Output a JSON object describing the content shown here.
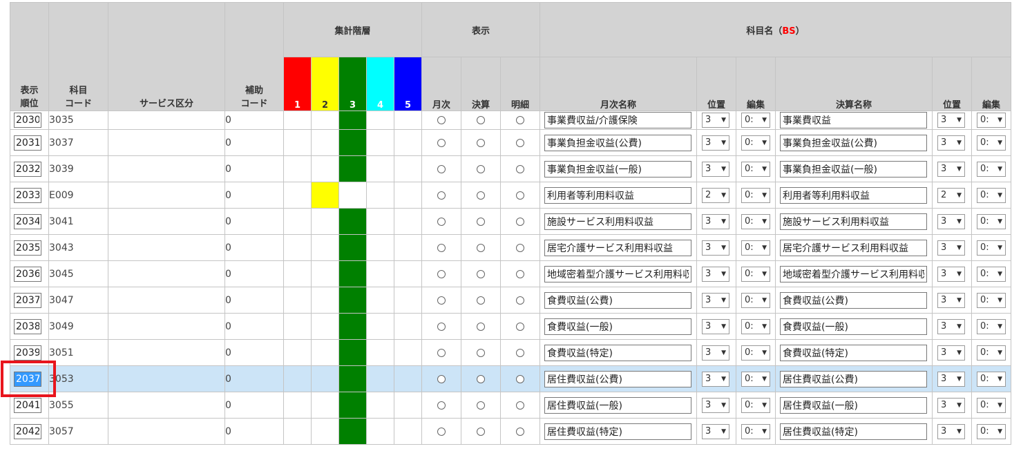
{
  "headers": {
    "order": "表示\n順位",
    "code": "科目\nコード",
    "service": "サービス区分",
    "hojo": "補助\nコード",
    "level_group": "集計階層",
    "levels": [
      "1",
      "2",
      "3",
      "4",
      "5"
    ],
    "display_group": "表示",
    "display": [
      "月次",
      "決算",
      "明細"
    ],
    "name_group_prefix": "科目名（",
    "name_group_tag": "BS",
    "name_group_suffix": "）",
    "monthly_name": "月次名称",
    "position": "位置",
    "edit": "編集",
    "closing_name": "決算名称",
    "position2": "位置",
    "edit2": "編集"
  },
  "colors": {
    "level1": "#ff0000",
    "level2": "#ffff00",
    "level3": "#008000",
    "level4": "#00ffff",
    "level5": "#0000ff",
    "selected_row": "#cce4f7",
    "highlight": "#e8151d"
  },
  "rows": [
    {
      "order": "2030",
      "code": "3035",
      "hojo": "0",
      "level": 3,
      "monthly": "事業費収益/介護保険",
      "pos": "3",
      "edit": "0:",
      "closing": "事業費収益",
      "pos2": "3",
      "edit2": "0:",
      "partial": true
    },
    {
      "order": "2031",
      "code": "3037",
      "hojo": "0",
      "level": 3,
      "monthly": "事業負担金収益(公費)",
      "pos": "3",
      "edit": "0:",
      "closing": "事業負担金収益(公費)",
      "pos2": "3",
      "edit2": "0:"
    },
    {
      "order": "2032",
      "code": "3039",
      "hojo": "0",
      "level": 3,
      "monthly": "事業負担金収益(一般)",
      "pos": "3",
      "edit": "0:",
      "closing": "事業負担金収益(一般)",
      "pos2": "3",
      "edit2": "0:"
    },
    {
      "order": "2033",
      "code": "E009",
      "hojo": "0",
      "level": 2,
      "monthly": "利用者等利用料収益",
      "pos": "2",
      "edit": "0:",
      "closing": "利用者等利用料収益",
      "pos2": "2",
      "edit2": "0:"
    },
    {
      "order": "2034",
      "code": "3041",
      "hojo": "0",
      "level": 3,
      "monthly": "施設サービス利用料収益",
      "pos": "3",
      "edit": "0:",
      "closing": "施設サービス利用料収益",
      "pos2": "3",
      "edit2": "0:"
    },
    {
      "order": "2035",
      "code": "3043",
      "hojo": "0",
      "level": 3,
      "monthly": "居宅介護サービス利用料収益",
      "pos": "3",
      "edit": "0:",
      "closing": "居宅介護サービス利用料収益",
      "pos2": "3",
      "edit2": "0:"
    },
    {
      "order": "2036",
      "code": "3045",
      "hojo": "0",
      "level": 3,
      "monthly": "地域密着型介護サービス利用料収益",
      "pos": "3",
      "edit": "0:",
      "closing": "地域密着型介護サービス利用料収益",
      "pos2": "3",
      "edit2": "0:"
    },
    {
      "order": "2037",
      "code": "3047",
      "hojo": "0",
      "level": 3,
      "monthly": "食費収益(公費)",
      "pos": "3",
      "edit": "0:",
      "closing": "食費収益(公費)",
      "pos2": "3",
      "edit2": "0:"
    },
    {
      "order": "2038",
      "code": "3049",
      "hojo": "0",
      "level": 3,
      "monthly": "食費収益(一般)",
      "pos": "3",
      "edit": "0:",
      "closing": "食費収益(一般)",
      "pos2": "3",
      "edit2": "0:"
    },
    {
      "order": "2039",
      "code": "3051",
      "hojo": "0",
      "level": 3,
      "monthly": "食費収益(特定)",
      "pos": "3",
      "edit": "0:",
      "closing": "食費収益(特定)",
      "pos2": "3",
      "edit2": "0:"
    },
    {
      "order": "2037",
      "code": "3053",
      "hojo": "0",
      "level": 3,
      "monthly": "居住費収益(公費)",
      "pos": "3",
      "edit": "0:",
      "closing": "居住費収益(公費)",
      "pos2": "3",
      "edit2": "0:",
      "selected": true
    },
    {
      "order": "2041",
      "code": "3055",
      "hojo": "0",
      "level": 3,
      "monthly": "居住費収益(一般)",
      "pos": "3",
      "edit": "0:",
      "closing": "居住費収益(一般)",
      "pos2": "3",
      "edit2": "0:"
    },
    {
      "order": "2042",
      "code": "3057",
      "hojo": "0",
      "level": 3,
      "monthly": "居住費収益(特定)",
      "pos": "3",
      "edit": "0:",
      "closing": "居住費収益(特定)",
      "pos2": "3",
      "edit2": "0:"
    }
  ]
}
